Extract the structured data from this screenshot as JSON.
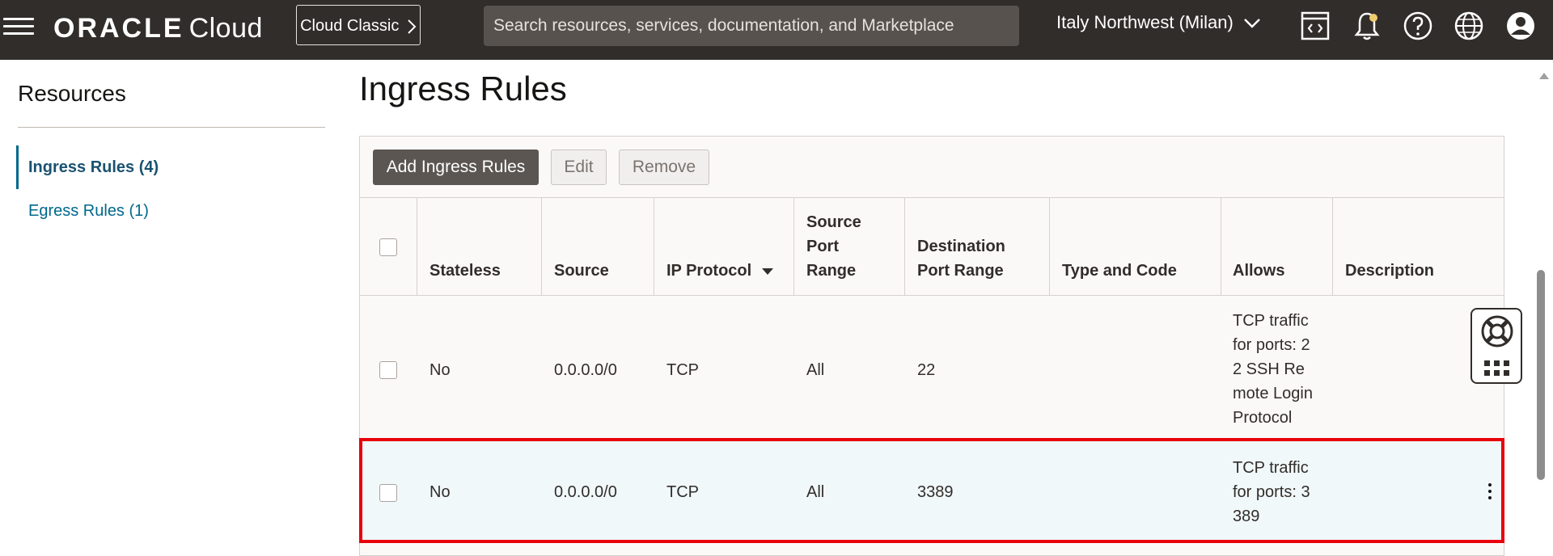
{
  "header": {
    "logo_brand": "ORACLE",
    "logo_product": "Cloud",
    "classic_button": "Cloud Classic",
    "search_placeholder": "Search resources, services, documentation, and Marketplace",
    "region": "Italy Northwest (Milan)",
    "icons": [
      "code-editor-icon",
      "bell-icon",
      "help-icon",
      "globe-icon",
      "user-icon"
    ]
  },
  "sidebar": {
    "title": "Resources",
    "items": [
      {
        "label": "Ingress Rules (4)",
        "active": true
      },
      {
        "label": "Egress Rules (1)",
        "active": false
      }
    ]
  },
  "main": {
    "title": "Ingress Rules",
    "toolbar": {
      "add_label": "Add Ingress Rules",
      "edit_label": "Edit",
      "remove_label": "Remove"
    },
    "table": {
      "columns": {
        "stateless": "Stateless",
        "source": "Source",
        "ip_protocol": "IP Protocol",
        "source_port_range_1": "Source",
        "source_port_range_2": "Port",
        "source_port_range_3": "Range",
        "dest_port_range_1": "Destination",
        "dest_port_range_2": "Port Range",
        "type_and_code": "Type and Code",
        "allows": "Allows",
        "description": "Description"
      },
      "rows": [
        {
          "stateless": "No",
          "source": "0.0.0.0/0",
          "ip_protocol": "TCP",
          "source_port_range": "All",
          "dest_port_range": "22",
          "type_and_code": "",
          "allows_lines": [
            "TCP traffic",
            "for ports: 2",
            "2 SSH Re",
            "mote Login",
            "Protocol"
          ],
          "description": ""
        },
        {
          "stateless": "No",
          "source": "0.0.0.0/0",
          "ip_protocol": "TCP",
          "source_port_range": "All",
          "dest_port_range": "3389",
          "type_and_code": "",
          "allows_lines": [
            "TCP traffic",
            "for ports: 3",
            "389"
          ],
          "description": ""
        }
      ]
    }
  },
  "colors": {
    "header_bg": "#312d2a",
    "link": "#00688c",
    "highlight_border": "#e8000b",
    "primary_button": "#5b5652"
  }
}
